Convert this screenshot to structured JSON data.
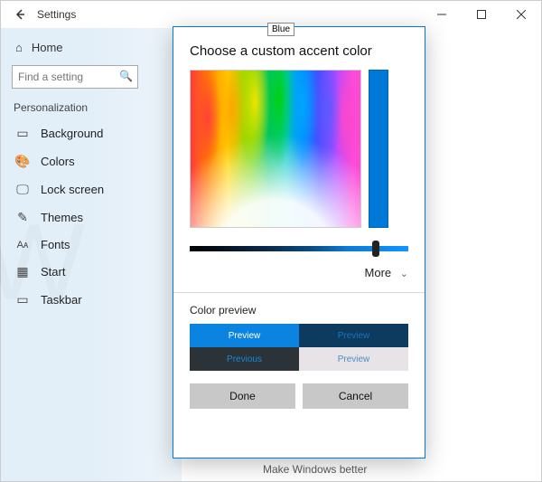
{
  "titlebar": {
    "title": "Settings"
  },
  "sidebar": {
    "home": "Home",
    "search_placeholder": "Find a setting",
    "header": "Personalization",
    "items": [
      {
        "label": "Background"
      },
      {
        "label": "Colors"
      },
      {
        "label": "Lock screen"
      },
      {
        "label": "Themes"
      },
      {
        "label": "Fonts"
      },
      {
        "label": "Start"
      },
      {
        "label": "Taskbar"
      }
    ]
  },
  "dialog": {
    "title": "Choose a custom accent color",
    "tooltip": "Blue",
    "more_label": "More",
    "preview_label": "Color preview",
    "preview_tiles": {
      "a": "Preview",
      "b": "Preview",
      "c": "Previous",
      "d": "Preview"
    },
    "done": "Done",
    "cancel": "Cancel",
    "accent_hex": "#0078d7"
  },
  "footer_hint": "Make Windows better"
}
